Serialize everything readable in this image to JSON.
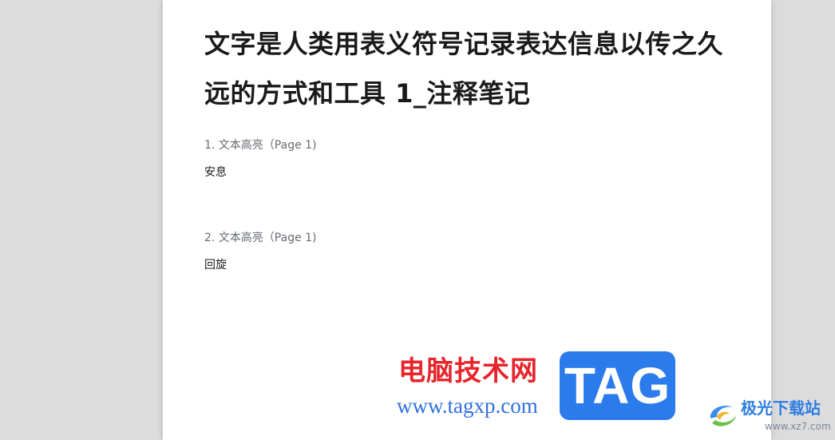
{
  "document": {
    "title": "文字是人类用表义符号记录表达信息以传之久远的方式和工具 1_注释笔记",
    "notes": [
      {
        "header": "1. 文本高亮（Page 1)",
        "text": "安息"
      },
      {
        "header": "2. 文本高亮（Page 1)",
        "text": "回旋"
      }
    ]
  },
  "watermarks": {
    "site_name": "电脑技术网",
    "site_url": "www.tagxp.com",
    "tag_logo_text": "TAG",
    "download_site_name": "极光下载站",
    "download_site_url": "www.xz7.com",
    "download_logo_icon": "swirl-logo-icon"
  },
  "colors": {
    "app_background": "#dcdcdc",
    "page_background": "#ffffff",
    "title_text": "#1a1a1a",
    "note_header_text": "#666a72",
    "watermark_red": "#e8242c",
    "watermark_blue": "#2c7bec"
  }
}
